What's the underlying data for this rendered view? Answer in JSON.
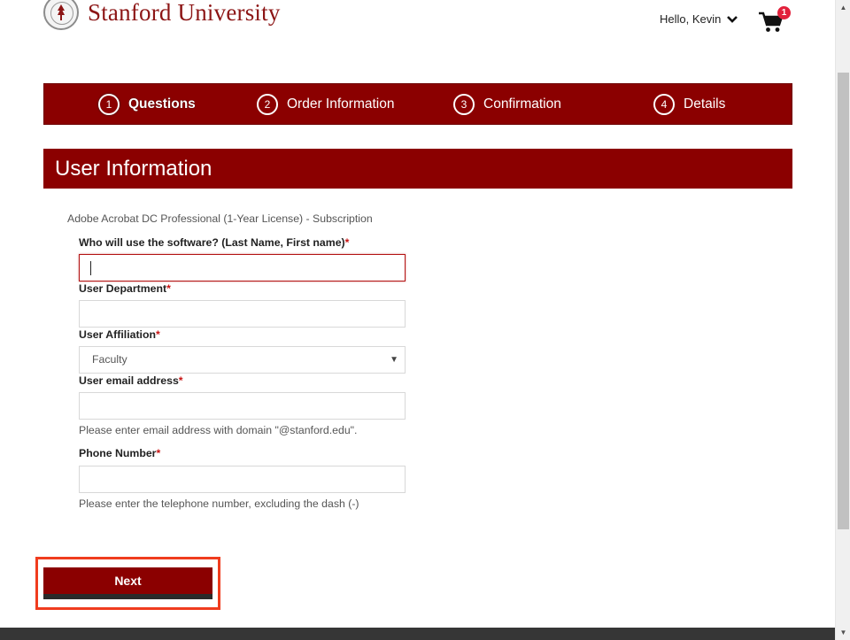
{
  "header": {
    "university_name": "Stanford University",
    "greeting": "Hello, Kevin",
    "cart_count": "1"
  },
  "steps": [
    {
      "number": "1",
      "label": "Questions",
      "active": true
    },
    {
      "number": "2",
      "label": "Order Information",
      "active": false
    },
    {
      "number": "3",
      "label": "Confirmation",
      "active": false
    },
    {
      "number": "4",
      "label": "Details",
      "active": false
    }
  ],
  "section": {
    "title": "User Information"
  },
  "form": {
    "product": "Adobe Acrobat DC Professional (1-Year License) - Subscription",
    "required_mark": "*",
    "fields": {
      "user_name": {
        "label": "Who will use the software? (Last Name, First name)",
        "value": ""
      },
      "department": {
        "label": "User Department",
        "value": ""
      },
      "affiliation": {
        "label": "User Affiliation",
        "value": "Faculty"
      },
      "email": {
        "label": "User email address",
        "value": "",
        "help": "Please enter email address with domain \"@stanford.edu\"."
      },
      "phone": {
        "label": "Phone Number",
        "value": "",
        "help": "Please enter the telephone number, excluding the dash (-)"
      }
    }
  },
  "actions": {
    "next_label": "Next"
  },
  "colors": {
    "brand": "#8b0000",
    "stanford_red": "#8c1515",
    "highlight": "#f03c1e",
    "badge": "#e2203b"
  },
  "icons": [
    "stanford-seal-icon",
    "chevron-down-icon",
    "cart-icon",
    "select-arrow-icon",
    "scroll-up-arrow-icon",
    "scroll-down-arrow-icon"
  ]
}
